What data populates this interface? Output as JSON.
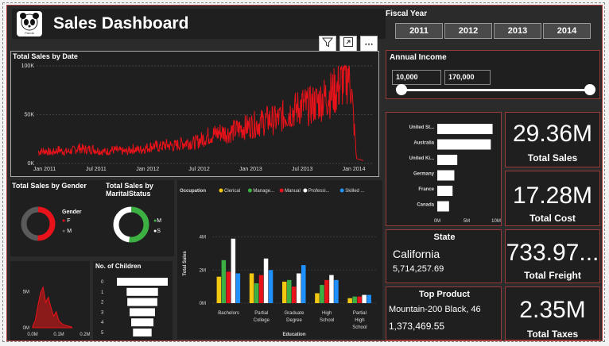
{
  "header": {
    "logo_text": "Panda",
    "title": "Sales Dashboard"
  },
  "toolbar": {
    "filter_icon": "filter-icon",
    "focus_icon": "focus-mode-icon",
    "more_icon": "more-options-icon"
  },
  "fiscal_year": {
    "label": "Fiscal Year",
    "options": [
      "2011",
      "2012",
      "2013",
      "2014"
    ]
  },
  "annual_income": {
    "label": "Annual Income",
    "min": "10,000",
    "max": "170,000"
  },
  "kpis": [
    {
      "value": "29.36M",
      "label": "Total Sales"
    },
    {
      "value": "17.28M",
      "label": "Total Cost"
    },
    {
      "value": "733.97...",
      "label": "Total Freight"
    },
    {
      "value": "2.35M",
      "label": "Total Taxes"
    }
  ],
  "state_card": {
    "title": "State",
    "name": "California",
    "value": "5,714,257.69"
  },
  "product_card": {
    "title": "Top Product",
    "name": "Mountain-200 Black, 46",
    "value": "1,373,469.55"
  },
  "colors": {
    "accent_red": "#e8121a",
    "panel": "#1f1f1f",
    "border": "#9b3a3a"
  },
  "chart_data": [
    {
      "type": "line",
      "title": "Total Sales by Date",
      "x_ticks": [
        "Jan 2011",
        "Jul 2011",
        "Jan 2012",
        "Jul 2012",
        "Jan 2013",
        "Jul 2013",
        "Jan 2014"
      ],
      "y_ticks": [
        "0K",
        "50K",
        "100K"
      ],
      "ylim": [
        0,
        100000
      ],
      "series": [
        {
          "values": [
            12000,
            13000,
            11000,
            14000,
            12000,
            13000,
            16000,
            14000,
            15000,
            13000,
            12000,
            14000,
            13000,
            12000,
            15000,
            14000,
            16000,
            18000,
            17000,
            19000,
            18000,
            20000,
            22000,
            21000,
            24000,
            28000,
            30000,
            32000,
            31000,
            34000,
            36000,
            38000,
            40000,
            42000,
            45000,
            44000,
            48000,
            52000,
            55000,
            60000,
            58000,
            62000,
            66000,
            70000,
            75000,
            85000,
            95000,
            5000,
            3000
          ]
        }
      ]
    },
    {
      "type": "pie",
      "title": "Total Sales by Gender",
      "legend_title": "Gender",
      "categories": [
        "F",
        "M"
      ],
      "values": [
        50.4,
        49.6
      ]
    },
    {
      "type": "pie",
      "title": "Total Sales by MaritalStatus",
      "categories": [
        "M",
        "S"
      ],
      "values": [
        52,
        48
      ]
    },
    {
      "type": "bar",
      "orientation": "horizontal",
      "categories": [
        "United St...",
        "Australia",
        "United Ki...",
        "Germany",
        "France",
        "Canada"
      ],
      "values": [
        9.4,
        9.1,
        3.4,
        2.9,
        2.6,
        2.0
      ],
      "x_ticks": [
        "0M",
        "5M",
        "10M"
      ],
      "xlim": [
        0,
        10
      ]
    },
    {
      "type": "bar",
      "xlabel": "Education",
      "ylabel": "Total Sales",
      "legend_title": "Occupation",
      "categories": [
        "Bachelors",
        "Partial College",
        "Graduate Degree",
        "High School",
        "Partial High School"
      ],
      "y_ticks": [
        "0M",
        "2M",
        "4M"
      ],
      "ylim": [
        0,
        4.8
      ],
      "series": [
        {
          "name": "Clerical",
          "color": "#f2c811",
          "values": [
            1.6,
            1.8,
            1.3,
            0.6,
            0.3
          ]
        },
        {
          "name": "Manage...",
          "color": "#3cb043",
          "values": [
            2.6,
            1.2,
            1.4,
            1.1,
            0.4
          ]
        },
        {
          "name": "Manual",
          "color": "#e8121a",
          "values": [
            1.9,
            1.7,
            1.0,
            1.4,
            0.4
          ]
        },
        {
          "name": "Professi...",
          "color": "#ffffff",
          "values": [
            3.9,
            2.7,
            1.8,
            1.7,
            0.5
          ]
        },
        {
          "name": "Skilled ...",
          "color": "#1e90ff",
          "values": [
            1.8,
            2.0,
            2.3,
            1.4,
            0.5
          ]
        }
      ]
    },
    {
      "type": "area",
      "y_ticks": [
        "0M",
        "5M"
      ],
      "x_ticks": [
        "0.0M",
        "0.1M",
        "0.2M"
      ],
      "ylim": [
        0,
        7
      ],
      "values": [
        0.2,
        1.0,
        3.0,
        4.8,
        5.6,
        3.5,
        4.2,
        2.8,
        1.6,
        2.2,
        1.0,
        0.6,
        0.4,
        0.3,
        0.2,
        0.1
      ]
    },
    {
      "type": "bar",
      "title": "No. of Children",
      "subtype": "funnel",
      "categories": [
        "0",
        "1",
        "2",
        "3",
        "4",
        "5"
      ],
      "values": [
        11.2,
        6.9,
        6.6,
        5.6,
        4.9,
        4.1
      ]
    }
  ]
}
